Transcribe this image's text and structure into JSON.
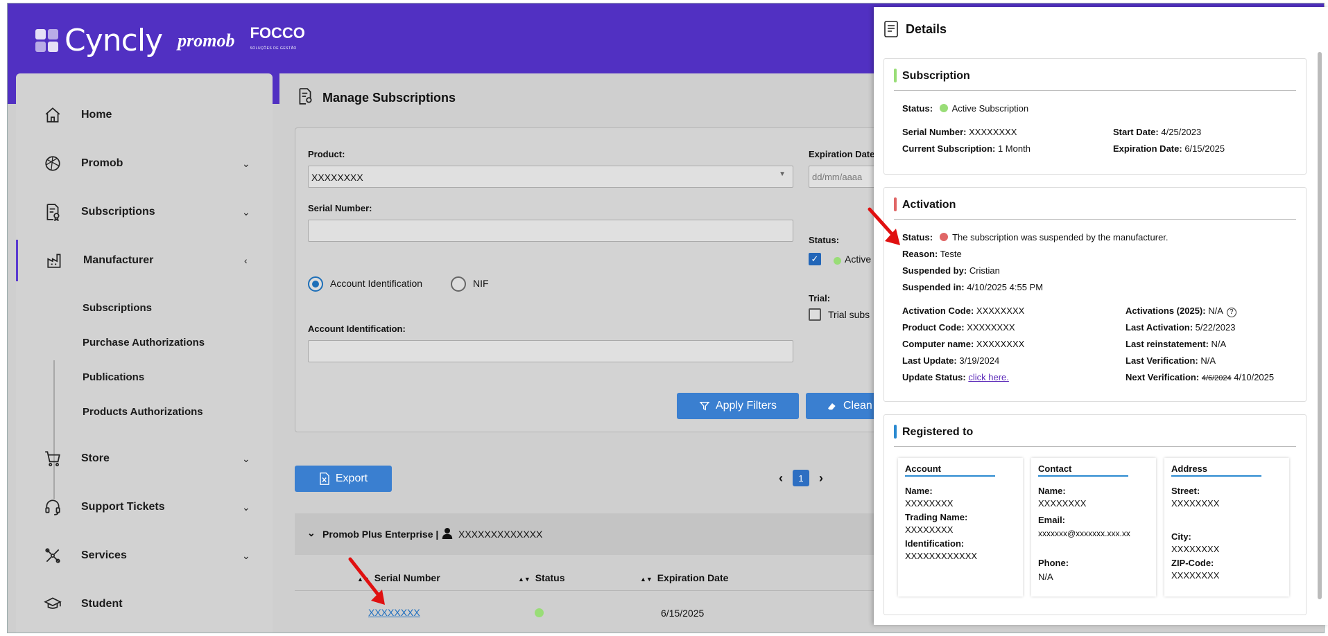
{
  "brand": {
    "cyncly": "Cyncly",
    "promob": "promob",
    "focco": "FOCCO",
    "focco_sub": "SOLUÇÕES DE GESTÃO"
  },
  "sidebar": {
    "items": [
      {
        "label": "Home",
        "icon": "home-icon"
      },
      {
        "label": "Promob",
        "icon": "promob-icon"
      },
      {
        "label": "Subscriptions",
        "icon": "subscriptions-icon"
      },
      {
        "label": "Manufacturer",
        "icon": "factory-icon"
      },
      {
        "label": "Store",
        "icon": "cart-icon"
      },
      {
        "label": "Support Tickets",
        "icon": "headset-icon"
      },
      {
        "label": "Services",
        "icon": "services-icon"
      },
      {
        "label": "Student",
        "icon": "graduation-cap-icon"
      }
    ],
    "manufacturer_sub": [
      "Subscriptions",
      "Purchase Authorizations",
      "Publications",
      "Products Authorizations"
    ]
  },
  "main": {
    "title": "Manage Subscriptions",
    "filters": {
      "product_label": "Product:",
      "product_value": "XXXXXXXX",
      "serial_label": "Serial Number:",
      "radio_account": "Account Identification",
      "radio_nif": "NIF",
      "account_label": "Account Identification:",
      "expiration_label": "Expiration Date",
      "expiration_placeholder": "dd/mm/aaaa",
      "status_label": "Status:",
      "status_active": "Active",
      "trial_label": "Trial:",
      "trial_option": "Trial subs",
      "apply_button": "Apply Filters",
      "clean_button": "Clean"
    },
    "export_button": "Export",
    "page": "1",
    "group": {
      "product": "Promob Plus Enterprise |",
      "account": "XXXXXXXXXXXXX"
    },
    "table": {
      "headers": [
        "Serial Number",
        "Status",
        "Expiration Date"
      ],
      "rows": [
        {
          "serial": "XXXXXXXX",
          "expiration": "6/15/2025"
        }
      ]
    }
  },
  "details": {
    "title": "Details",
    "subscription": {
      "title": "Subscription",
      "status_label": "Status:",
      "status_value": "Active Subscription",
      "serial_label": "Serial Number:",
      "serial_value": "XXXXXXXX",
      "current_label": "Current Subscription:",
      "current_value": "1 Month",
      "start_label": "Start Date:",
      "start_value": "4/25/2023",
      "expiration_label": "Expiration Date:",
      "expiration_value": "6/15/2025"
    },
    "activation": {
      "title": "Activation",
      "status_label": "Status:",
      "status_value": "The subscription was suspended by the manufacturer.",
      "reason_label": "Reason:",
      "reason_value": "Teste",
      "suspended_by_label": "Suspended by:",
      "suspended_by_value": "Cristian",
      "suspended_in_label": "Suspended in:",
      "suspended_in_value": "4/10/2025 4:55 PM",
      "code_label": "Activation Code:",
      "code_value": "XXXXXXXX",
      "product_code_label": "Product Code:",
      "product_code_value": "XXXXXXXX",
      "computer_label": "Computer name:",
      "computer_value": "XXXXXXXX",
      "last_update_label": "Last Update:",
      "last_update_value": "3/19/2024",
      "update_status_label": "Update Status:",
      "update_status_link": "click here.",
      "activations_label": "Activations (2025):",
      "activations_value": "N/A",
      "last_activation_label": "Last Activation:",
      "last_activation_value": "5/22/2023",
      "last_reinstatement_label": "Last reinstatement:",
      "last_reinstatement_value": "N/A",
      "last_verification_label": "Last Verification:",
      "last_verification_value": "N/A",
      "next_verification_label": "Next Verification:",
      "next_verification_old": "4/6/2024",
      "next_verification_value": "4/10/2025"
    },
    "registered": {
      "title": "Registered to",
      "account": {
        "title": "Account",
        "name_label": "Name:",
        "name_value": "XXXXXXXX",
        "trading_label": "Trading Name:",
        "trading_value": "XXXXXXXX",
        "ident_label": "Identification:",
        "ident_value": "XXXXXXXXXXXX"
      },
      "contact": {
        "title": "Contact",
        "name_label": "Name:",
        "name_value": "XXXXXXXX",
        "email_label": "Email:",
        "email_value": "xxxxxxx@xxxxxxx.xxx.xx",
        "phone_label": "Phone:",
        "phone_value": "N/A"
      },
      "address": {
        "title": "Address",
        "street_label": "Street:",
        "street_value": "XXXXXXXX",
        "city_label": "City:",
        "city_value": "XXXXXXXX",
        "zip_label": "ZIP-Code:",
        "zip_value": "XXXXXXXX"
      }
    }
  },
  "colors": {
    "header": "#5130c2",
    "accent_blue": "#3a7fd0",
    "green": "#99dd77",
    "red": "#e06666",
    "subscription_bar": "#99dd77",
    "activation_bar": "#e06666",
    "registered_bar": "#2b8ad0",
    "annotation_arrow": "#e01010"
  }
}
